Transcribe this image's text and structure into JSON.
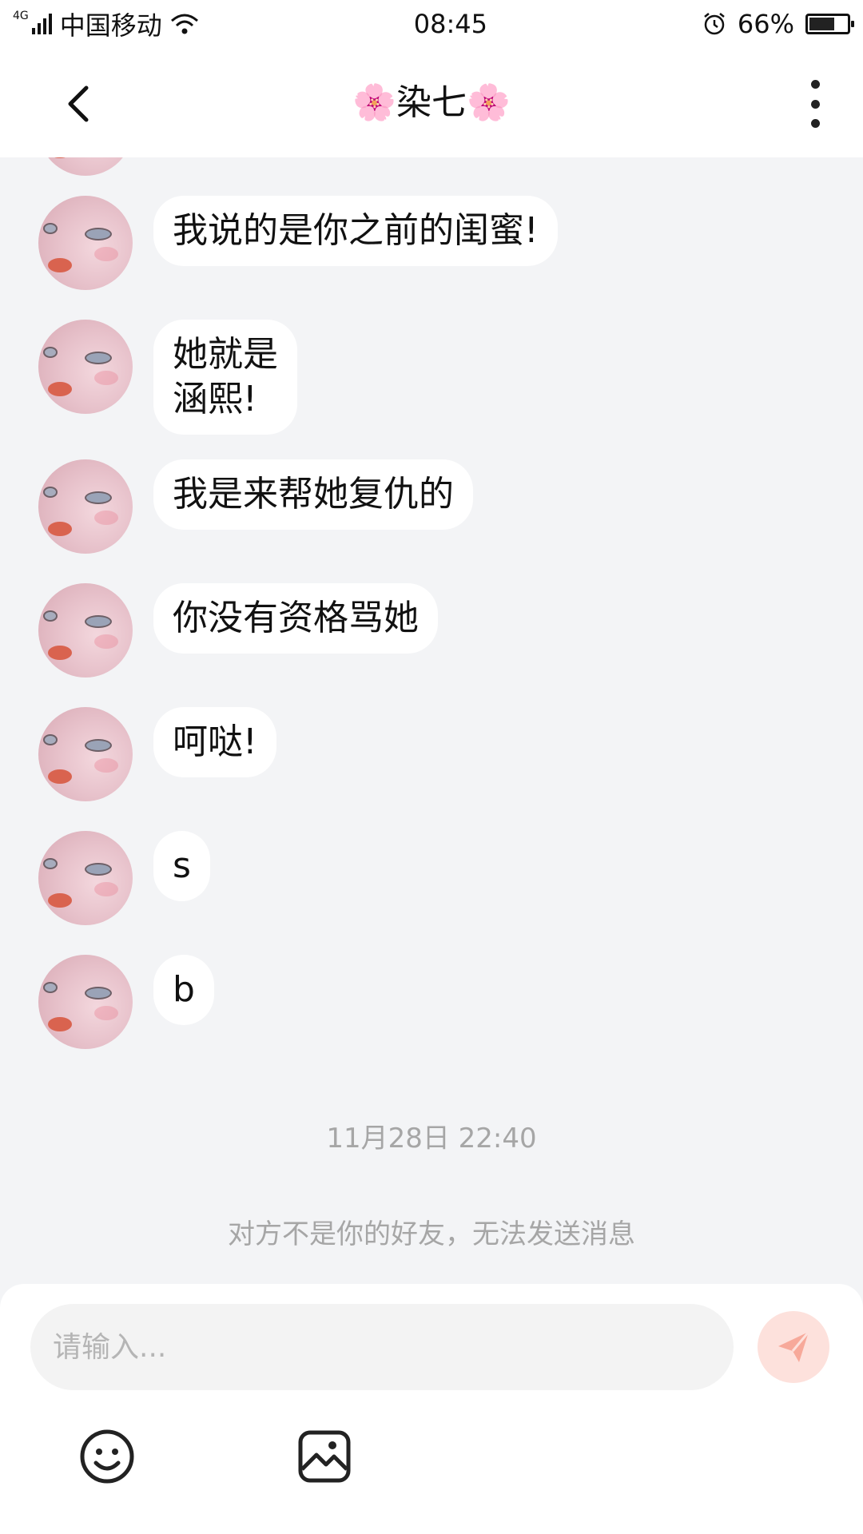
{
  "status_bar": {
    "network_type": "4G",
    "carrier": "中国移动",
    "time": "08:45",
    "battery": "66%"
  },
  "header": {
    "title": "🌸染七🌸",
    "back_icon": "chevron-left-icon",
    "more_icon": "more-vertical-icon"
  },
  "messages": [
    {
      "sender": "other",
      "text": "我说的是你之前的闺蜜!"
    },
    {
      "sender": "other",
      "text": "她就是\n涵熙!"
    },
    {
      "sender": "other",
      "text": "我是来帮她复仇的"
    },
    {
      "sender": "other",
      "text": "你没有资格骂她"
    },
    {
      "sender": "other",
      "text": "呵哒!"
    },
    {
      "sender": "other",
      "text": "s"
    },
    {
      "sender": "other",
      "text": "b"
    }
  ],
  "timestamp": "11月28日 22:40",
  "notice": "对方不是你的好友，无法发送消息",
  "composer": {
    "placeholder": "请输入...",
    "send_icon": "paper-plane-icon",
    "tools": [
      "emoji-icon",
      "image-icon"
    ]
  },
  "colors": {
    "background": "#f3f4f6",
    "bubble": "#ffffff",
    "send_button": "#fde1dc",
    "send_icon": "#f7a99a",
    "muted_text": "#a6a6a6"
  }
}
